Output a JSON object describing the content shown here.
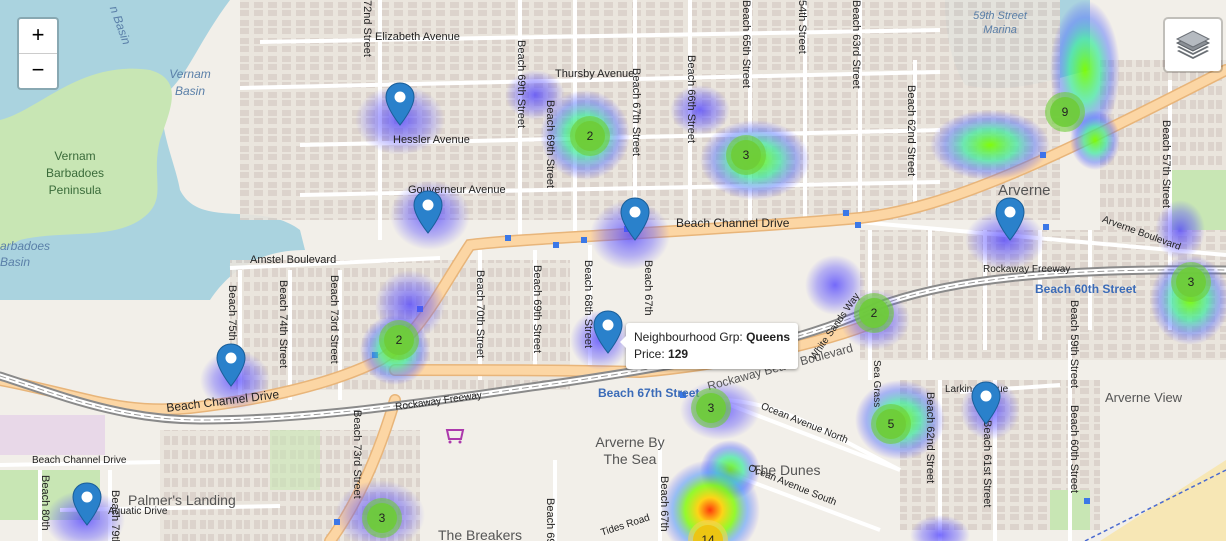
{
  "map": {
    "labels": {
      "basin_top": "n Basin",
      "vernam_basin": "Vernam Basin",
      "vernam_barbadoes": "Vernam Barbadoes Peninsula",
      "barbadoes_basin": "arbadoes Basin",
      "marina": "59th Street Marina",
      "elizabeth_ave": "Elizabeth Avenue",
      "thursby_ave": "Thursby Avenue",
      "hessler_ave": "Hessler Avenue",
      "gouverneur_ave": "Gouverneur Avenue",
      "amstel_blvd": "Amstel Boulevard",
      "beach_channel_dr_top": "Beach Channel Drive",
      "beach_channel_dr_left": "Beach Channel Drive",
      "beach_channel_dr_bottom": "Beach Channel Drive",
      "rockaway_fwy_left": "Rockaway Freeway",
      "rockaway_fwy_right": "Rockaway Freeway",
      "rockaway_blvd": "Rockaway Beach Boulevard",
      "arverne_blvd": "Arverne Boulevard",
      "arverne": "Arverne",
      "arverne_by_the_sea": "Arverne By The Sea",
      "the_dunes": "The Dunes",
      "arverne_view": "Arverne View",
      "palmers_landing": "Palmer's Landing",
      "aquatic_drive": "Aquatic Drive",
      "the_breakers": "The Breakers",
      "tides_road": "Tides Road",
      "ocean_ave_north": "Ocean Avenue North",
      "ocean_ave_south": "Ocean Avenue South",
      "white_sands_way": "White Sands Way",
      "sea_grass": "Sea Grass",
      "larkin_ave": "Larkin Avenue",
      "station_67": "Beach 67th Street",
      "station_60": "Beach 60th Street",
      "b72": "72nd Street",
      "b69a": "Beach 69th Street",
      "b69b": "Beach 69th Street",
      "b67": "Beach 67th Street",
      "b66": "Beach 66th Street",
      "b65": "Beach 65th Street",
      "b64": "54th Street",
      "b63": "Beach 63rd Street",
      "b62": "Beach 62nd Street",
      "b62b": "Beach 62nd Street",
      "b61": "Beach 61st Street",
      "b60": "Beach 60th Street",
      "b59": "Beach 59th Street",
      "b57": "Beach 57th Street",
      "b75": "Beach 75th",
      "b74": "Beach 74th Street",
      "b73": "Beach 73rd Street",
      "b73b": "Beach 73rd Street",
      "b70": "Beach 70th Street",
      "b69c": "Beach 69th Street",
      "b68": "Beach 68th Street",
      "b67b": "Beach 67th",
      "b80": "Beach 80th",
      "b79": "Beach 79th",
      "b67c": "Beach 67th",
      "b69d": "Beach 69"
    },
    "clusters": [
      {
        "count": "2"
      },
      {
        "count": "3"
      },
      {
        "count": "9"
      },
      {
        "count": "2"
      },
      {
        "count": "2"
      },
      {
        "count": "3"
      },
      {
        "count": "3"
      },
      {
        "count": "5"
      },
      {
        "count": "3"
      },
      {
        "count": "14"
      }
    ],
    "markers": [
      "hessler",
      "gouverneur",
      "beach-channel",
      "arverne-blvd",
      "beach-75th",
      "beach-68th",
      "beach-61st",
      "beach-80th"
    ]
  },
  "controls": {
    "zoom_in": "+",
    "zoom_out": "−"
  },
  "tooltip": {
    "group_label": "Neighbourhood Grp:",
    "group_value": "Queens",
    "price_label": "Price:",
    "price_value": "129"
  },
  "colors": {
    "water": "#aad3df",
    "land": "#f2efe9",
    "primary_road": "#fcd6a4",
    "freeway": "#8a8a8a",
    "marker": "#2a81cb",
    "cluster_small": "#6ecc39",
    "heat_low": "#3f4fd6",
    "heat_mid": "#7cfc00",
    "heat_high": "#ff5a00"
  }
}
